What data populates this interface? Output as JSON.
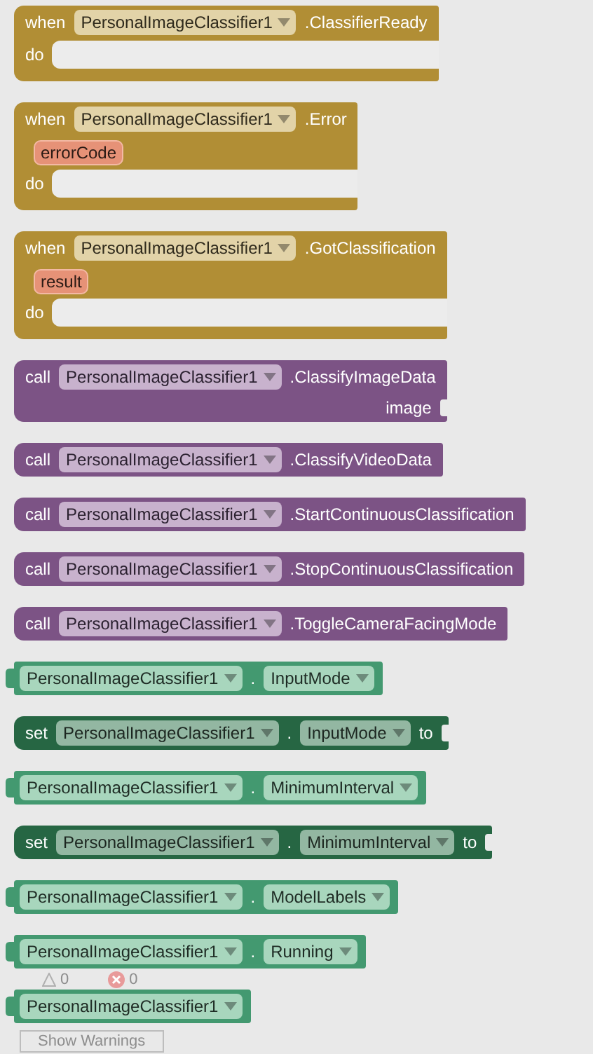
{
  "blocks": [
    {
      "kind": "event",
      "keyword": "when",
      "component": "PersonalImageClassifier1",
      "member": ".ClassifierReady",
      "body_label": "do"
    },
    {
      "kind": "event",
      "keyword": "when",
      "component": "PersonalImageClassifier1",
      "member": ".Error",
      "param": "errorCode",
      "body_label": "do"
    },
    {
      "kind": "event",
      "keyword": "when",
      "component": "PersonalImageClassifier1",
      "member": ".GotClassification",
      "param": "result",
      "body_label": "do"
    },
    {
      "kind": "call",
      "keyword": "call",
      "component": "PersonalImageClassifier1",
      "member": ".ClassifyImageData",
      "socket_label": "image"
    },
    {
      "kind": "call",
      "keyword": "call",
      "component": "PersonalImageClassifier1",
      "member": ".ClassifyVideoData"
    },
    {
      "kind": "call",
      "keyword": "call",
      "component": "PersonalImageClassifier1",
      "member": ".StartContinuousClassification"
    },
    {
      "kind": "call",
      "keyword": "call",
      "component": "PersonalImageClassifier1",
      "member": ".StopContinuousClassification"
    },
    {
      "kind": "call",
      "keyword": "call",
      "component": "PersonalImageClassifier1",
      "member": ".ToggleCameraFacingMode"
    },
    {
      "kind": "getter",
      "component": "PersonalImageClassifier1",
      "separator": ".",
      "property": "InputMode"
    },
    {
      "kind": "setter",
      "keyword": "set",
      "component": "PersonalImageClassifier1",
      "separator": ".",
      "property": "InputMode",
      "trailing": "to"
    },
    {
      "kind": "getter",
      "component": "PersonalImageClassifier1",
      "separator": ".",
      "property": "MinimumInterval"
    },
    {
      "kind": "setter",
      "keyword": "set",
      "component": "PersonalImageClassifier1",
      "separator": ".",
      "property": "MinimumInterval",
      "trailing": "to"
    },
    {
      "kind": "getter",
      "component": "PersonalImageClassifier1",
      "separator": ".",
      "property": "ModelLabels"
    },
    {
      "kind": "getter",
      "component": "PersonalImageClassifier1",
      "separator": ".",
      "property": "Running"
    },
    {
      "kind": "component",
      "component": "PersonalImageClassifier1"
    }
  ],
  "warnings": {
    "warning_count": "0",
    "error_count": "0",
    "button": "Show Warnings"
  }
}
